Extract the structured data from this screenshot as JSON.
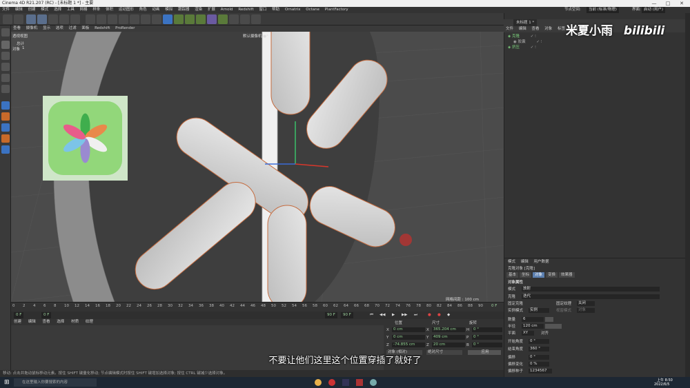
{
  "window": {
    "title": "Cinema 4D R21.207 (RC) - [未标题 1 *] - 主要",
    "minimize": "—",
    "maximize": "□",
    "close": "✕"
  },
  "menubar": {
    "items": [
      "文件",
      "编辑",
      "创建",
      "模式",
      "选择",
      "工具",
      "网格",
      "样条",
      "体积",
      "运动图形",
      "角色",
      "动画",
      "模拟",
      "跟踪器",
      "渲染",
      "扩展",
      "Arnold",
      "Redshift",
      "窗口",
      "帮助",
      "Ornatrix",
      "Octane",
      "PlantFactory"
    ]
  },
  "rightmenu": {
    "node_space_label": "节点空间:",
    "node_space_value": "当前 (标准/物理)",
    "layout_label": "界面:",
    "layout_value": "启动 (用户)"
  },
  "viewport_menu": {
    "items": [
      "查看",
      "摄像机",
      "显示",
      "选项",
      "过滤",
      "面板",
      "Redshift",
      "ProRender"
    ],
    "view_name": "透视视图",
    "camera_tag": "默认摄像机 ●°",
    "grid_spacing": "网格间距 : 100 cm",
    "hud_1": "对象",
    "hud_1_value": "1",
    "hud_0": "总计"
  },
  "timeline": {
    "ticks": [
      "0",
      "2",
      "4",
      "6",
      "8",
      "10",
      "12",
      "14",
      "16",
      "18",
      "20",
      "22",
      "24",
      "26",
      "28",
      "30",
      "32",
      "34",
      "36",
      "38",
      "40",
      "42",
      "44",
      "46",
      "48",
      "50",
      "52",
      "54",
      "56",
      "58",
      "60",
      "62",
      "64",
      "66",
      "68",
      "70",
      "72",
      "74",
      "76",
      "78",
      "80",
      "82",
      "84",
      "86",
      "88",
      "90"
    ],
    "current_frame": "0 F",
    "end_marker": "0 F",
    "start_field": "0 F",
    "start_field2": "0 F",
    "end_field": "90 F",
    "end_field2": "90 F"
  },
  "material_menu": {
    "items": [
      "创建",
      "编辑",
      "查看",
      "选择",
      "材质",
      "纹理"
    ]
  },
  "coords": {
    "header_pos": "位置",
    "header_size": "尺寸",
    "header_rot": "旋转",
    "x_pos": "0 cm",
    "y_pos": "0 cm",
    "z_pos": "-74.855 cm",
    "x_size": "365.204 cm",
    "y_size": "409 cm",
    "z_size": "20 cm",
    "h_rot": "0 °",
    "p_rot": "0 °",
    "b_rot": "0 °",
    "mode_object": "对象 (相对)",
    "mode_size": "绝对尺寸",
    "apply_button": "应用"
  },
  "statusbar": {
    "text": "移动: 点击并拖动鼠标移动元素。按住 SHIFT 键量化移动; 节点编辑模式时按住 SHIFT 键增加选择对象; 按住 CTRL 键减少选择对象。"
  },
  "taskbar": {
    "search_placeholder": "在这里输入你要搜索的内容",
    "time": "上午 8:50",
    "date": "2022/6/5"
  },
  "objects": {
    "tab_title": "未标题 1 *",
    "menu": [
      "文件",
      "编辑",
      "查看",
      "对象",
      "标签",
      "书签"
    ],
    "rows": [
      {
        "name": "克隆",
        "flags": "✓ ⁝"
      },
      {
        "name": "胶囊",
        "flags": "✓ ⁝"
      },
      {
        "name": "挤压",
        "flags": "✓ ⁝"
      }
    ]
  },
  "attributes": {
    "menu": [
      "模式",
      "编辑",
      "用户数据"
    ],
    "object_title": "克隆对象 [克隆]",
    "tabs": [
      "基本",
      "坐标",
      "对象",
      "变换",
      "效果器"
    ],
    "active_tab": "对象",
    "section": "对象属性",
    "mode_label": "模式",
    "mode_value": "放射",
    "clone_label": "克隆",
    "clone_value": "迭代",
    "fix_clone_label": "固定克隆",
    "fix_texture_label": "固定纹理",
    "fix_texture_value": "关闭",
    "instance_label": "实例模式",
    "instance_value": "实例",
    "viewport_label": "视窗模式",
    "viewport_value": "对象",
    "count_label": "数量",
    "count_value": "6",
    "radius_label": "半径",
    "radius_value": "120 cm",
    "plane_label": "平面",
    "plane_value": "XY",
    "align_label": "对齐",
    "start_angle_label": "开始角度",
    "start_angle_value": "0 °",
    "end_angle_label": "结束角度",
    "end_angle_value": "360 °",
    "offset_label": "偏移",
    "offset_value": "0 °",
    "offset_var_label": "偏移变化",
    "offset_var_value": "0 %",
    "offset_seed_label": "偏移种子",
    "offset_seed_value": "1234567"
  },
  "subtitle": "不要让他们这里这个位置穿插了就好了",
  "watermark": "米夏小雨",
  "bili": "bilibili"
}
